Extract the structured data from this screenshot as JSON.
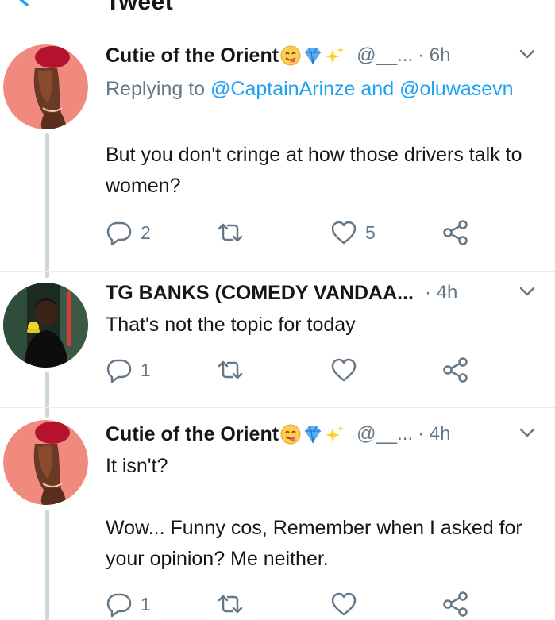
{
  "header": {
    "title": "Tweet"
  },
  "tweets": [
    {
      "name": "Cutie of the Orient",
      "handle": "@__...",
      "time": "· 6h",
      "replying_prefix": "Replying to",
      "replying_mention1": "@CaptainArinze",
      "replying_and": "and",
      "replying_mention2": "@oluwasevn",
      "text": "But you don't cringe at how those drivers talk to women?",
      "replies": "2",
      "retweets": "",
      "likes": "5"
    },
    {
      "name": "TG BANKS (COMEDY VANDAA...",
      "handle": "",
      "time": "· 4h",
      "text": "That's not the topic for today",
      "replies": "1",
      "retweets": "",
      "likes": ""
    },
    {
      "name": "Cutie of the Orient",
      "handle": "@__...",
      "time": "· 4h",
      "text1": "It isn't?",
      "text2": "Wow... Funny cos, Remember when I asked for your opinion? Me neither.",
      "replies": "1",
      "retweets": "",
      "likes": ""
    }
  ],
  "icons": {
    "back": "back-arrow-icon",
    "chevron": "chevron-down-icon",
    "reply": "reply-icon",
    "retweet": "retweet-icon",
    "like": "heart-icon",
    "share": "share-icon"
  },
  "colors": {
    "accent": "#1da1f2",
    "secondary_text": "#657786",
    "thread_line": "#ccd6dd"
  }
}
